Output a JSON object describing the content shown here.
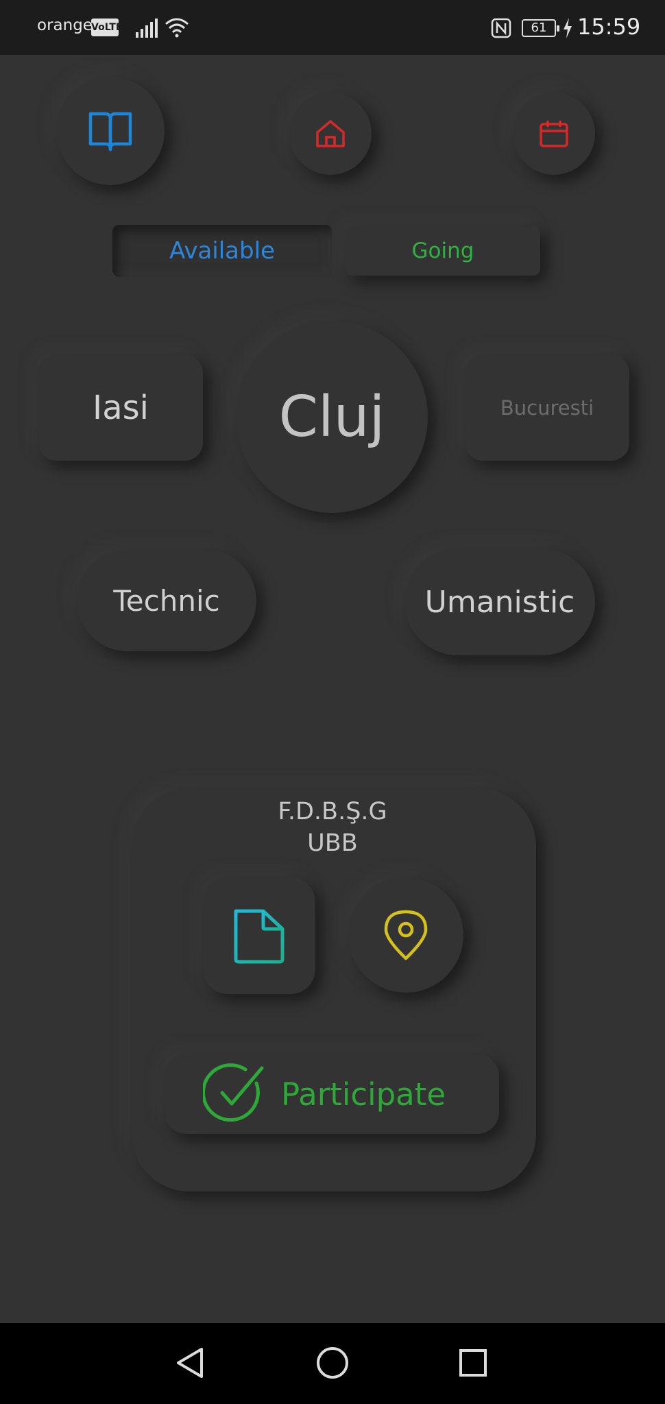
{
  "status_bar": {
    "carrier": "orange",
    "volte": "VoLTE",
    "battery": "61",
    "time": "15:59"
  },
  "top_icons": {
    "book": {
      "icon": "book-icon",
      "color": "#1e86d8"
    },
    "home": {
      "icon": "home-icon",
      "color": "#d62a2a"
    },
    "calendar": {
      "icon": "calendar-icon",
      "color": "#d62a2a"
    }
  },
  "toggle": {
    "available_label": "Available",
    "going_label": "Going",
    "selected": "Available",
    "available_color": "#2f86d6",
    "going_color": "#2fb240"
  },
  "cities": {
    "left": "Iasi",
    "center": "Cluj",
    "right": "Bucuresti",
    "selected": "Cluj"
  },
  "categories": {
    "technic": "Technic",
    "umanistic": "Umanistic"
  },
  "event_card": {
    "line1": "F.D.B.Ş.G",
    "line2": "UBB",
    "document_icon": "document-icon",
    "location_icon": "location-pin-icon",
    "participate_label": "Participate",
    "participate_icon": "check-circle-icon",
    "doc_color": "#1fb3c8",
    "loc_color": "#d4c21a",
    "participate_color": "#2fa83a"
  },
  "nav_bar": {
    "back_icon": "back-triangle-icon",
    "home_icon": "home-circle-icon",
    "recent_icon": "recent-square-icon"
  }
}
